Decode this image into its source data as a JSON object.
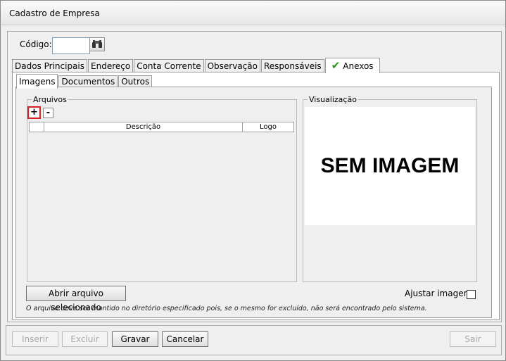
{
  "window": {
    "title": "Cadastro de Empresa"
  },
  "header": {
    "codigo_label": "Código:",
    "codigo_value": ""
  },
  "main_tabs": [
    {
      "label": "Dados Principais"
    },
    {
      "label": "Endereço"
    },
    {
      "label": "Conta Corrente"
    },
    {
      "label": "Observação"
    },
    {
      "label": "Responsáveis"
    },
    {
      "label": "Anexos",
      "icon": "check-icon",
      "active": true
    }
  ],
  "sub_tabs": [
    {
      "label": "Imagens",
      "active": true
    },
    {
      "label": "Documentos"
    },
    {
      "label": "Outros"
    }
  ],
  "arquivos": {
    "legend": "Arquivos",
    "add_label": "+",
    "remove_label": "-",
    "columns": [
      "Descrição",
      "Logo"
    ],
    "rows": []
  },
  "visualizacao": {
    "legend": "Visualização",
    "placeholder": "SEM IMAGEM"
  },
  "open_button": "Abrir arquivo selecionado",
  "ajustar_label": "Ajustar imagens",
  "ajustar_checked": false,
  "note": "O arquivo deve ser mantido no diretório especificado pois, se o mesmo for excluído, não será encontrado pelo sistema.",
  "buttons": {
    "inserir": "Inserir",
    "excluir": "Excluir",
    "gravar": "Gravar",
    "cancelar": "Cancelar",
    "sair": "Sair"
  },
  "colors": {
    "highlight": "#e02020",
    "check": "#1f9b1f"
  }
}
